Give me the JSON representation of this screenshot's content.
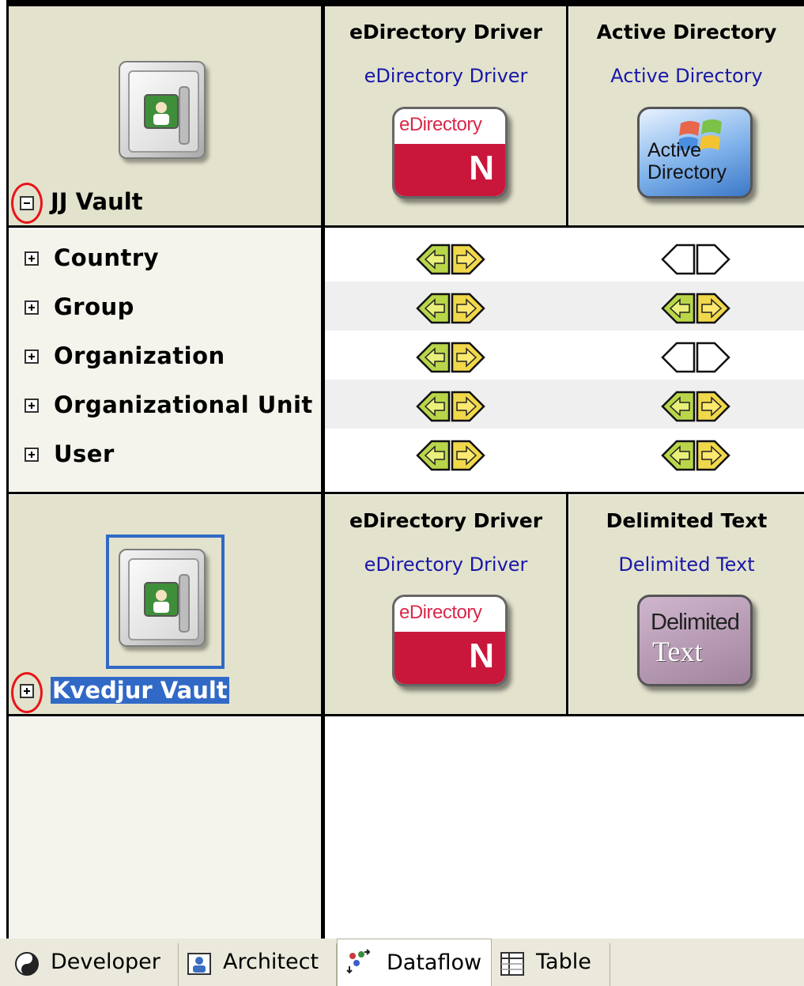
{
  "vaults": [
    {
      "name": "JJ Vault",
      "expanded": true,
      "selected": false,
      "drivers": [
        {
          "title": "eDirectory Driver",
          "subtitle": "eDirectory Driver",
          "icon": "edirectory-icon",
          "icon_text": "eDirectory",
          "icon_letter": "N"
        },
        {
          "title": "Active Directory",
          "subtitle": "Active Directory",
          "icon": "active-directory-icon",
          "icon_text": [
            "Active",
            "Directory"
          ]
        }
      ],
      "classes": [
        {
          "name": "Country",
          "driver_flow": [
            "both",
            "none"
          ]
        },
        {
          "name": "Group",
          "driver_flow": [
            "both",
            "both"
          ]
        },
        {
          "name": "Organization",
          "driver_flow": [
            "both",
            "none"
          ]
        },
        {
          "name": "Organizational Unit",
          "driver_flow": [
            "both",
            "both"
          ]
        },
        {
          "name": "User",
          "driver_flow": [
            "both",
            "both"
          ]
        }
      ]
    },
    {
      "name": "Kvedjur Vault",
      "expanded": false,
      "selected": true,
      "drivers": [
        {
          "title": "eDirectory Driver",
          "subtitle": "eDirectory Driver",
          "icon": "edirectory-icon",
          "icon_text": "eDirectory",
          "icon_letter": "N"
        },
        {
          "title": "Delimited Text",
          "subtitle": "Delimited Text",
          "icon": "delimited-text-icon",
          "icon_text": [
            "Delimited",
            "Text"
          ]
        }
      ]
    }
  ],
  "tabs": [
    {
      "label": "Developer",
      "icon": "yin-yang-icon",
      "active": false
    },
    {
      "label": "Architect",
      "icon": "architect-icon",
      "active": false
    },
    {
      "label": "Dataflow",
      "icon": "dataflow-icon",
      "active": true
    },
    {
      "label": "Table",
      "icon": "table-icon",
      "active": false
    }
  ],
  "colors": {
    "header_bg": "#e3e2cd",
    "row_stripe": "#efefef",
    "link_text": "#1818a8",
    "selection": "#3169c6",
    "highlight_circle": "#e8141a"
  }
}
